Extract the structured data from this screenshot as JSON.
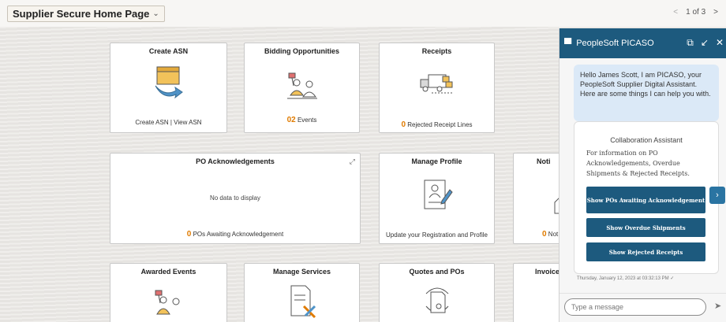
{
  "topbar": {
    "page_title": "Supplier Secure Home Page",
    "page_chevron": "⌄",
    "pager_prev": "<",
    "pager_text": "1 of 3",
    "pager_next": ">"
  },
  "tiles": {
    "create_asn": {
      "title": "Create ASN",
      "footer": "Create ASN | View ASN"
    },
    "bidding": {
      "title": "Bidding Opportunities",
      "count": "02",
      "count_label": "Events"
    },
    "receipts": {
      "title": "Receipts",
      "count": "0",
      "count_label": "Rejected Receipt Lines"
    },
    "po_ack": {
      "title": "PO Acknowledgements",
      "nodata": "No data to display",
      "count": "0",
      "count_label": "POs Awaiting Acknowledgement"
    },
    "manage_profile": {
      "title": "Manage Profile",
      "footer": "Update your Registration and Profile"
    },
    "notifications": {
      "title": "Noti",
      "count": "0",
      "count_label": "Not"
    },
    "awarded_events": {
      "title": "Awarded Events"
    },
    "manage_services": {
      "title": "Manage Services"
    },
    "quotes_pos": {
      "title": "Quotes and POs"
    },
    "invoices": {
      "title": "Invoices"
    }
  },
  "chat": {
    "title": "PeopleSoft PICASO",
    "greeting": "Hello James Scott, I am PICASO, your PeopleSoft Supplier Digital Assistant. Here are some things I can help you with.",
    "card_title": "Collaboration Assistant",
    "card_desc": "For information on PO Acknowledgements, Overdue Shipments & Rejected Receipts.",
    "actions": [
      "Show POs Awaiting Acknowledgement",
      "Show Overdue Shipments",
      "Show Rejected Receipts"
    ],
    "timestamp": "Thursday, January 12, 2023 at 03:32:13 PM ✓",
    "input_placeholder": "Type a message"
  },
  "colors": {
    "accent": "#1d5a7e",
    "count_orange": "#e07b00"
  }
}
